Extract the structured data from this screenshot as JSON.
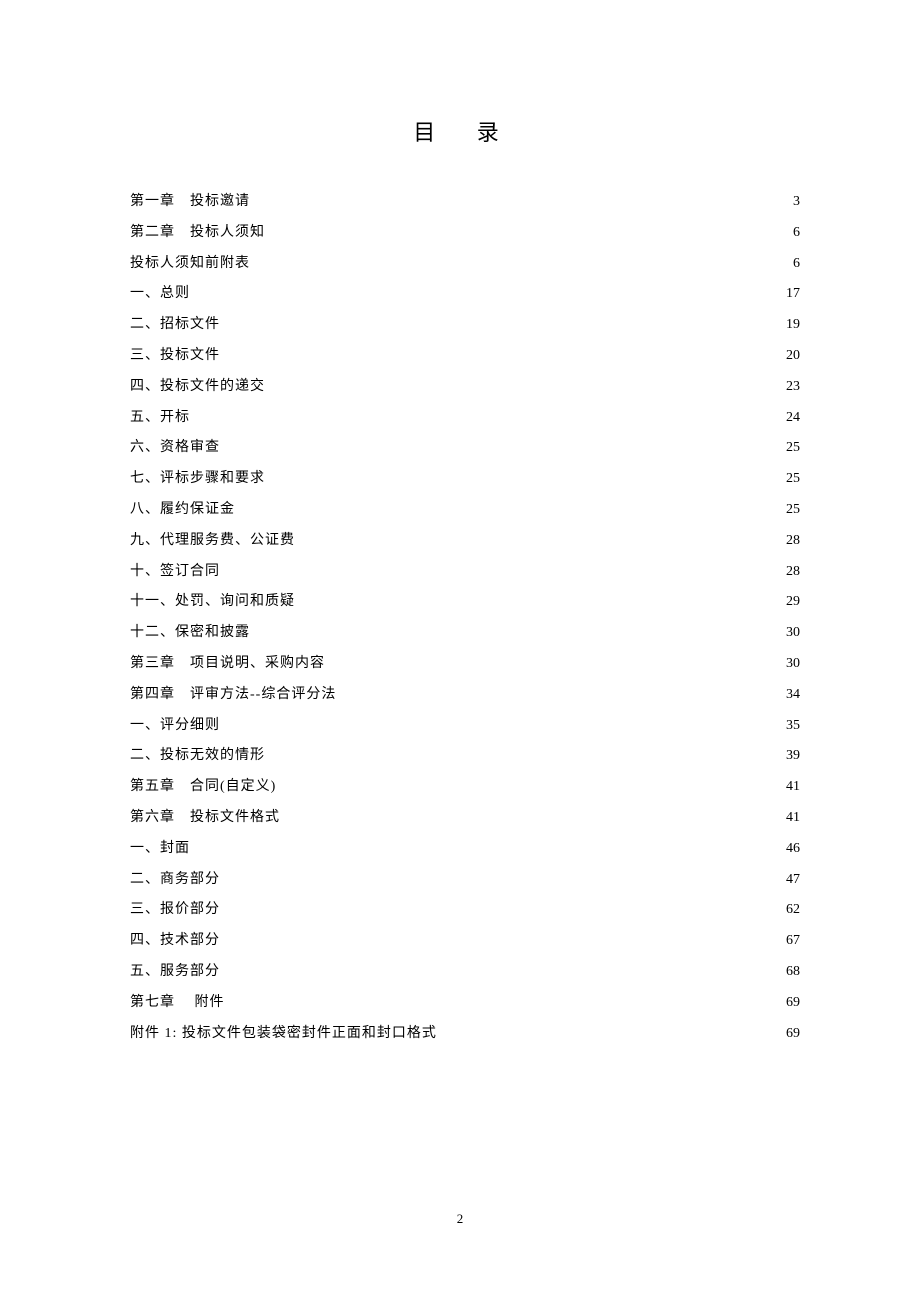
{
  "title": "目 录",
  "entries": [
    {
      "label": "第一章　投标邀请",
      "page": "3"
    },
    {
      "label": "第二章　投标人须知",
      "page": "6"
    },
    {
      "label": "投标人须知前附表",
      "page": "6"
    },
    {
      "label": "一、总则",
      "page": "17"
    },
    {
      "label": "二、招标文件",
      "page": "19"
    },
    {
      "label": "三、投标文件",
      "page": "20"
    },
    {
      "label": "四、投标文件的递交",
      "page": "23"
    },
    {
      "label": "五、开标",
      "page": "24"
    },
    {
      "label": "六、资格审查",
      "page": "25"
    },
    {
      "label": "七、评标步骤和要求",
      "page": "25"
    },
    {
      "label": "八、履约保证金",
      "page": "25"
    },
    {
      "label": "九、代理服务费、公证费",
      "page": "28"
    },
    {
      "label": "十、签订合同",
      "page": "28"
    },
    {
      "label": "十一、处罚、询问和质疑",
      "page": "29"
    },
    {
      "label": "十二、保密和披露",
      "page": "30"
    },
    {
      "label": "第三章　项目说明、采购内容",
      "page": "30"
    },
    {
      "label": "第四章　评审方法--综合评分法",
      "page": "34"
    },
    {
      "label": "一、评分细则",
      "page": "35"
    },
    {
      "label": "二、投标无效的情形",
      "page": "39"
    },
    {
      "label": "第五章　合同(自定义)",
      "page": "41"
    },
    {
      "label": "第六章　投标文件格式",
      "page": "41"
    },
    {
      "label": "一、封面",
      "page": "46"
    },
    {
      "label": "二、商务部分",
      "page": "47"
    },
    {
      "label": "三、报价部分",
      "page": "62"
    },
    {
      "label": "四、技术部分",
      "page": "67"
    },
    {
      "label": "五、服务部分",
      "page": "68"
    },
    {
      "label": "第七章　 附件",
      "page": "69"
    },
    {
      "label": "附件 1: 投标文件包装袋密封件正面和封口格式",
      "page": "69"
    }
  ],
  "page_number": "2"
}
